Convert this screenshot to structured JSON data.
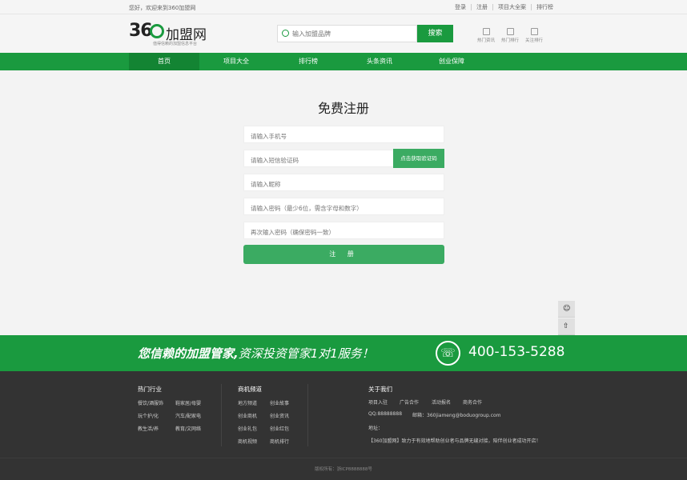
{
  "topbar": {
    "welcome": "您好，欢迎来到360加盟网",
    "links": [
      "登录",
      "注册",
      "项目大全案",
      "排行榜"
    ]
  },
  "header": {
    "logo_number": "36",
    "logo_brand": "加盟网",
    "logo_slogan": "值得信赖的加盟信息平台",
    "search_placeholder": "输入加盟品牌",
    "search_button": "搜索",
    "quick_links": [
      "热门资讯",
      "热门排行",
      "关注排行"
    ]
  },
  "nav": {
    "items": [
      "首页",
      "项目大全",
      "排行榜",
      "头条资讯",
      "创业保障"
    ],
    "active_index": 0
  },
  "form": {
    "title": "免费注册",
    "phone_placeholder": "请输入手机号",
    "sms_placeholder": "请输入短信验证码",
    "sms_button": "点击获取验证码",
    "nickname_placeholder": "请输入昵称",
    "password_placeholder": "请输入密码（最少6位，需含字母和数字）",
    "confirm_placeholder": "再次输入密码（确保密码一致）",
    "submit": "注 册"
  },
  "banner": {
    "slogan_bold": "您信赖的加盟管家,",
    "slogan_thin": "资深投资管家1对1服务！",
    "phone": "400-153-5288"
  },
  "footer": {
    "hot_industry": {
      "title": "热门行业",
      "items": [
        "餐饮/酒服饰",
        "鞋家居/母婴",
        "玩个护/化",
        "汽车/配家电",
        "教生活/养",
        "教育/文网络"
      ]
    },
    "business": {
      "title": "商机频道",
      "items": [
        "地方频道",
        "创业故事",
        "创业商机",
        "创业资讯",
        "创业礼包",
        "创业红包",
        "商机视频",
        "商机排行"
      ]
    },
    "about": {
      "title": "关于我们",
      "links": [
        "项目入驻",
        "广告合作",
        "活动报名",
        "商务合作"
      ],
      "qq": "QQ:88888888",
      "email": "邮箱：360jiameng@boduogroup.com",
      "address": "地址：",
      "intro": "【360加盟网】致力于有效地帮助创业者与品牌无缝对接，陪伴创业者成功开店！"
    },
    "copyright": "版权所有：浙ICP8888888号"
  },
  "colors": {
    "primary": "#1a9a3f",
    "primary_dark": "#138433",
    "button": "#3bab62",
    "footer_bg": "#333333"
  }
}
